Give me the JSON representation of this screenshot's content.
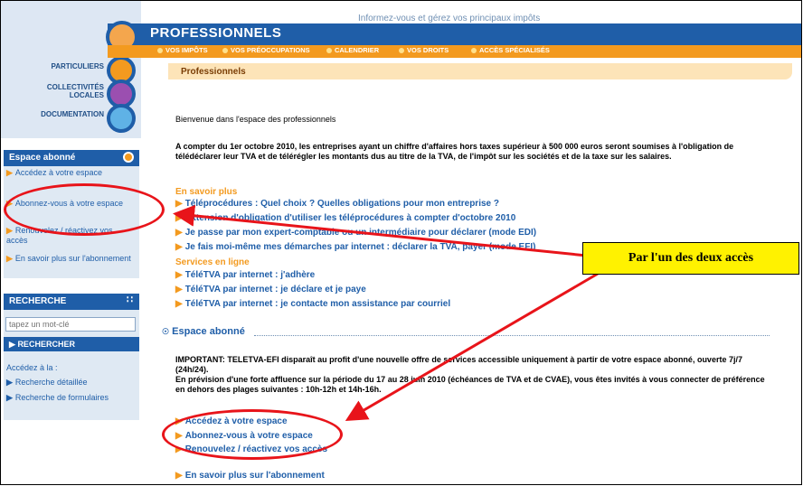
{
  "header": {
    "tagline": "Informez-vous et gérez vos principaux impôts",
    "brand": "PROFESSIONNELS",
    "nav": [
      "VOS IMPÔTS",
      "VOS PRÉOCCUPATIONS",
      "CALENDRIER",
      "VOS DROITS",
      "ACCÈS SPÉCIALISÉS"
    ],
    "breadcrumb": "Professionnels",
    "left_sections": [
      "PARTICULIERS",
      "COLLECTIVITÉS LOCALES",
      "DOCUMENTATION"
    ]
  },
  "sidebar": {
    "abonne_title": "Espace abonné",
    "abonne_links": [
      "Accédez à votre espace",
      "Abonnez-vous à votre espace",
      "Renouvelez / réactivez vos accès",
      "En savoir plus sur l'abonnement"
    ],
    "search_title": "RECHERCHE",
    "search_placeholder": "tapez un mot-clé",
    "search_button": "RECHERCHER",
    "acces_label": "Accédez à la :",
    "acces_links": [
      "Recherche détaillée",
      "Recherche de formulaires"
    ]
  },
  "main": {
    "welcome": "Bienvenue dans l'espace des professionnels",
    "intro": "A compter du 1er octobre 2010, les entreprises ayant un chiffre d'affaires hors taxes supérieur à 500 000 euros seront soumises à l'obligation de télédéclarer leur TVA et de télérégler les montants dus au titre de la TVA, de l'impôt sur les sociétés et de la taxe sur les salaires.",
    "en_savoir_plus_title": "En savoir plus",
    "en_savoir_plus_links": [
      "Téléprocédures : Quel choix ? Quelles obligations pour mon entreprise ?",
      "Extension d'obligation d'utiliser les téléprocédures à compter d'octobre 2010",
      "Je passe par mon expert-comptable ou un intermédiaire pour déclarer (mode EDI)",
      "Je fais moi-même mes démarches par internet : déclarer la TVA, payer (mode EFI)"
    ],
    "services_title": "Services en ligne",
    "services_links": [
      "TéléTVA par internet : j'adhère",
      "TéléTVA par internet : je déclare et je paye",
      "TéléTVA par internet : je contacte mon assistance par courriel"
    ],
    "espace_title": "Espace abonné",
    "important": "IMPORTANT: TELETVA-EFI disparaît au profit d'une nouvelle offre de services accessible uniquement à partir de votre espace abonné, ouverte 7j/7 (24h/24).",
    "notice": "En prévision d'une forte affluence sur la période du 17 au 28 juin 2010 (échéances de TVA et de CVAE), vous êtes invités à vous connecter de préférence en dehors des plages suivantes : 10h-12h et 14h-16h.",
    "espace_links": [
      "Accédez à votre espace",
      "Abonnez-vous à votre espace",
      "Renouvelez / réactivez vos accès"
    ],
    "bottom_link": "En savoir plus sur l'abonnement"
  },
  "annotation": {
    "callout": "Par l'un des deux accès",
    "color": "#e8141a"
  }
}
